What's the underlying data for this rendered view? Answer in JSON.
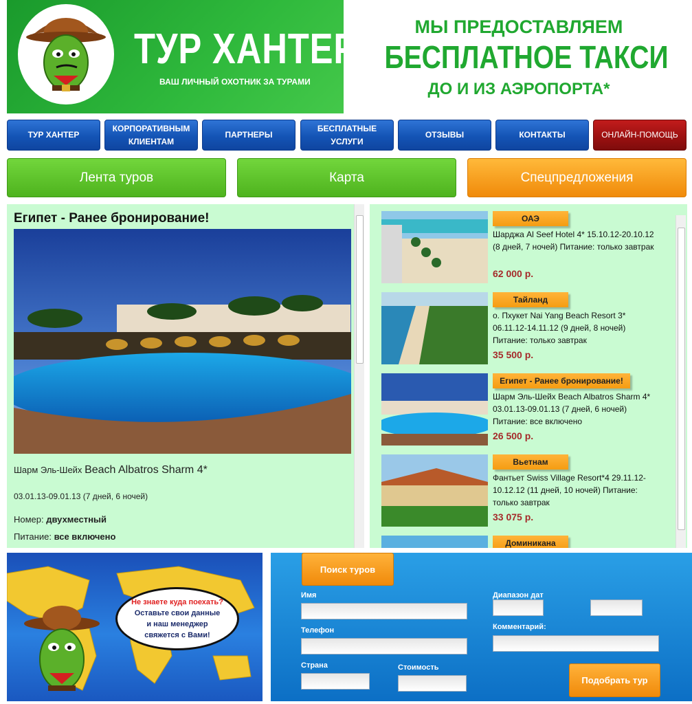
{
  "header": {
    "logo_title": "ТУР ХАНТЕР",
    "logo_subtitle": "ВАШ ЛИЧНЫЙ ОХОТНИК ЗА ТУРАМИ",
    "promo_line1": "МЫ ПРЕДОСТАВЛЯЕМ",
    "promo_line2": "БЕСПЛАТНОЕ ТАКСИ",
    "promo_line3": "ДО И ИЗ АЭРОПОРТА*"
  },
  "nav": {
    "items": [
      {
        "label": "ТУР ХАНТЕР"
      },
      {
        "label": "КОРПОРАТИВНЫМ КЛИЕНТАМ"
      },
      {
        "label": "ПАРТНЕРЫ"
      },
      {
        "label": "БЕСПЛАТНЫЕ УСЛУГИ"
      },
      {
        "label": "ОТЗЫВЫ"
      },
      {
        "label": "КОНТАКТЫ"
      },
      {
        "label": "ОНЛАЙН-ПОМОЩЬ"
      }
    ]
  },
  "tabs": {
    "tape": "Лента туров",
    "map": "Карта",
    "special": "Спецпредложения"
  },
  "feature": {
    "title": "Египет - Ранее бронирование!",
    "resort_prefix": "Шарм Эль-Шейх",
    "resort_name": "Beach Albatros Sharm 4*",
    "dates": "03.01.13-09.01.13 (7 дней, 6 ночей)",
    "room_label": "Номер:",
    "room_value": "двухместный",
    "meal_label": "Питание:",
    "meal_value": "все включено"
  },
  "tours": [
    {
      "badge": "ОАЭ",
      "desc": "Шарджа Al Seef Hotel 4* 15.10.12-20.10.12 (8 дней, 7 ночей) Питание: только завтрак",
      "price": "62 000 р."
    },
    {
      "badge": "Тайланд",
      "desc": "о. Пхукет Nai Yang Beach Resort 3* 06.11.12-14.11.12 (9 дней, 8 ночей) Питание: только завтрак",
      "price": "35 500 р."
    },
    {
      "badge": "Египет - Ранее бронирование!",
      "desc": "Шарм Эль-Шейх Beach Albatros Sharm 4* 03.01.13-09.01.13 (7 дней, 6 ночей) Питание: все включено",
      "price": "26 500 р."
    },
    {
      "badge": "Вьетнам",
      "desc": "Фантьет Swiss Village Resort*4 29.11.12-10.12.12 (11 дней, 10 ночей) Питание: только завтрак",
      "price": "33 075 р."
    },
    {
      "badge": "Доминикана",
      "desc": "",
      "price": ""
    }
  ],
  "map_block": {
    "bubble_line1": "Не знаете куда поехать?",
    "bubble_line2": "Оставьте свои данные",
    "bubble_line3": "и наш менеджер",
    "bubble_line4": "свяжется с Вами!"
  },
  "form": {
    "tab_label": "Поиск туров",
    "name_label": "Имя",
    "phone_label": "Телефон",
    "country_label": "Страна",
    "cost_label": "Стоимость",
    "dates_label": "Диапазон дат",
    "comment_label": "Комментарий:",
    "submit_label": "Подобрать тур"
  },
  "colors": {
    "brand_green": "#2fb93c",
    "nav_blue": "#1454b5",
    "help_red": "#991010",
    "accent_orange": "#f59c12",
    "price_red": "#a52a2a",
    "panel_mint": "#c9fbd2"
  }
}
